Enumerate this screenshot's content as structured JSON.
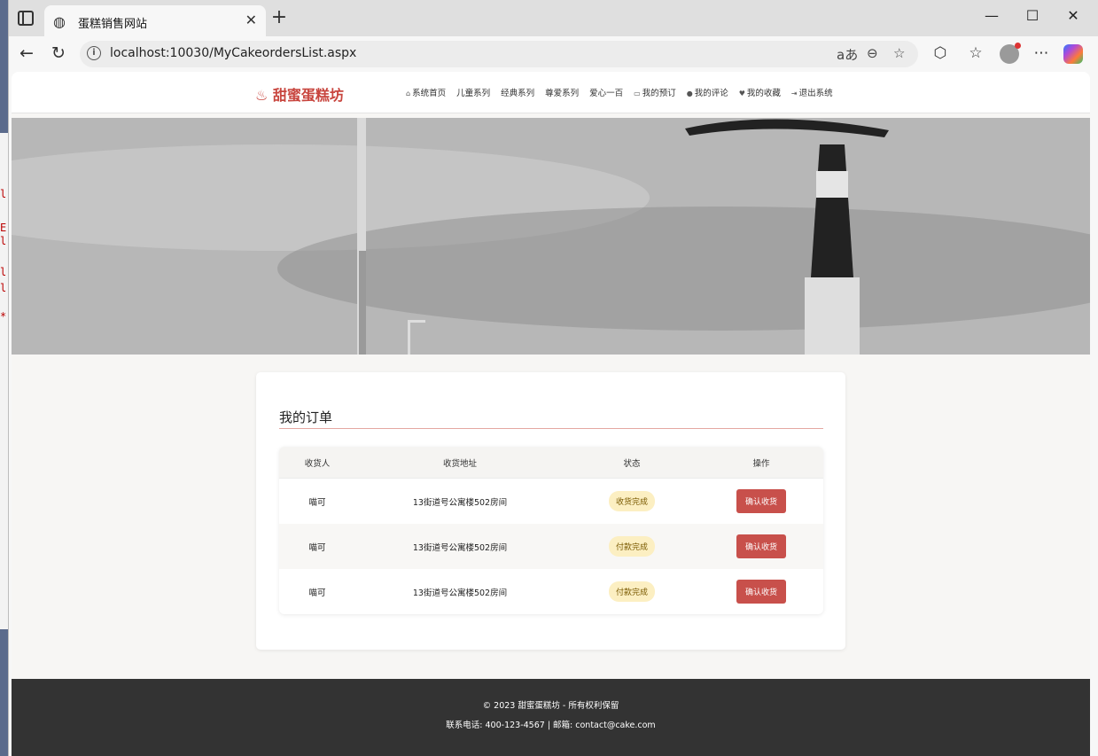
{
  "browser": {
    "tab_title": "蛋糕销售网站",
    "url": "localhost:10030/MyCakeordersList.aspx",
    "read_aloud_icon": "aあ"
  },
  "site": {
    "logo": "甜蜜蛋糕坊",
    "menu": [
      {
        "icon": "home-icon",
        "glyph": "⌂",
        "label": "系统首页"
      },
      {
        "icon": "",
        "glyph": "",
        "label": "儿童系列"
      },
      {
        "icon": "",
        "glyph": "",
        "label": "经典系列"
      },
      {
        "icon": "",
        "glyph": "",
        "label": "尊爱系列"
      },
      {
        "icon": "",
        "glyph": "",
        "label": "爱心一百"
      },
      {
        "icon": "card-icon",
        "glyph": "▭",
        "label": "我的预订"
      },
      {
        "icon": "comment-icon",
        "glyph": "●",
        "label": "我的评论"
      },
      {
        "icon": "heart-icon",
        "glyph": "♥",
        "label": "我的收藏"
      },
      {
        "icon": "logout-icon",
        "glyph": "⇥",
        "label": "退出系统"
      }
    ]
  },
  "orders": {
    "title": "我的订单",
    "headers": [
      "收货人",
      "收货地址",
      "状态",
      "操作"
    ],
    "rows": [
      {
        "receiver": "喵可",
        "address": "13街道号公寓楼502房间",
        "status": "收货完成",
        "action": "确认收货"
      },
      {
        "receiver": "喵可",
        "address": "13街道号公寓楼502房间",
        "status": "付款完成",
        "action": "确认收货"
      },
      {
        "receiver": "喵可",
        "address": "13街道号公寓楼502房间",
        "status": "付款完成",
        "action": "确认收货"
      }
    ]
  },
  "footer": {
    "copyright": "© 2023 甜蜜蛋糕坊 - 所有权利保留",
    "contact": "联系电话: 400-123-4567 | 邮箱: contact@cake.com"
  },
  "colors": {
    "brand": "#c8453e",
    "button": "#c8504b",
    "badge_bg": "#fcefc2",
    "footer_bg": "#333333"
  }
}
